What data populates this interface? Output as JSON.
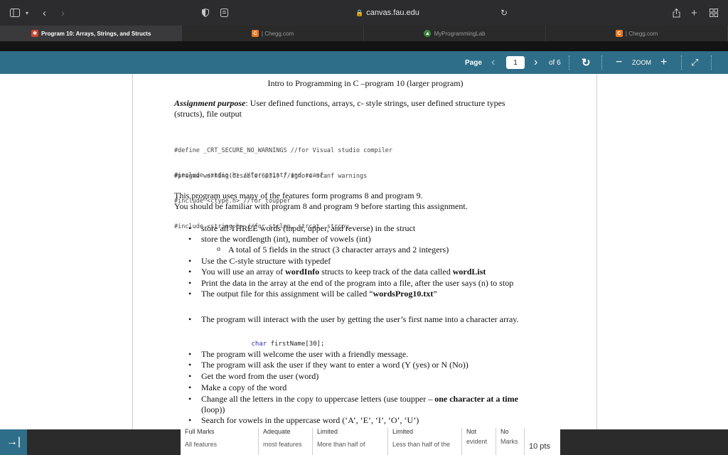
{
  "browser": {
    "address": "canvas.fau.edu",
    "tabs": [
      {
        "label": "Program 10: Arrays, Strings, and Structs",
        "active": true
      },
      {
        "label": "| Chegg.com",
        "active": false
      },
      {
        "label": "MyProgrammingLab",
        "active": false
      },
      {
        "label": "| Chegg.com",
        "active": false
      }
    ]
  },
  "pdf_toolbar": {
    "page_label": "Page",
    "page_value": "1",
    "of_label": "of 6",
    "zoom_label": "ZOOM"
  },
  "document": {
    "title": "Intro to Programming in C –program 10 (larger program)",
    "purpose_label": "Assignment purpose",
    "purpose_text": ": User defined functions, arrays, c- style strings, user defined structure types",
    "purpose_text2": "(structs), file output",
    "code_block1": [
      "#define _CRT_SECURE_NO_WARNINGS //for Visual studio compiler",
      "#pragma warning(disable:6031) //ignore scanf warnings"
    ],
    "code_block2": [
      "#include <stdio.h> //for printf and scanf",
      "#include <ctype.h> //for toupper",
      "#include <string.h> //for strlen, strcat, strcpy"
    ],
    "intro1": "This program uses many of the features form programs 8 and program 9.",
    "intro2": "You should be familiar with program 8 and program 9 before starting this assignment.",
    "bullets1": [
      "store all THREE words (input, upper, and reverse) in the struct",
      "store the wordlength (int), number of vowels (int)"
    ],
    "sub_bullet": "A total of 5 fields in the struct (3 character arrays and 2 integers)",
    "bullet_typedef": "Use the C-style structure with typedef",
    "bullet_array_pre": "You will use an array of ",
    "bullet_array_bold1": "wordInfo",
    "bullet_array_mid": " structs to keep track of the data called ",
    "bullet_array_bold2": "wordList",
    "bullet_print": "Print the data in the array at the end of the program into a file, after the user says (n) to stop",
    "bullet_output_pre": "The output file for this assignment will be called “",
    "bullet_output_bold": "wordsProg10.txt",
    "bullet_output_post": "”",
    "bullet_interact": "The program will interact with the user by getting the user’s first name into a character array.",
    "code_char_kw": "char",
    "code_char_rest": " firstName[30];",
    "bullets2": [
      "The program will welcome the user with a friendly message.",
      "The program will ask the user if they want to enter a word (Y (yes) or N (No))",
      "Get the word from the user (word)",
      "Make a copy of the word"
    ],
    "bullet_change_pre": "Change all the letters in the copy to uppercase letters (use toupper – ",
    "bullet_change_bold": "one character at a time",
    "bullet_change_post": "(loop))",
    "bullet_search": "Search for vowels in the uppercase word (‘A’, ‘E’, ‘I’, ‘O’, ‘U’)"
  },
  "rubric": {
    "cells": [
      {
        "title": "Full Marks",
        "desc": "All features"
      },
      {
        "title": "Adequate",
        "desc": "most features"
      },
      {
        "title": "Limited",
        "desc": "More than half of"
      },
      {
        "title": "Limited",
        "desc": "Less than half of the"
      },
      {
        "title": "Not",
        "desc": "evident"
      },
      {
        "title": "No",
        "desc": "Marks"
      }
    ],
    "points": "10 pts"
  },
  "colors": {
    "pdf_toolbar_bg": "#2f6e88",
    "browser_chrome": "#2c2c2e"
  }
}
